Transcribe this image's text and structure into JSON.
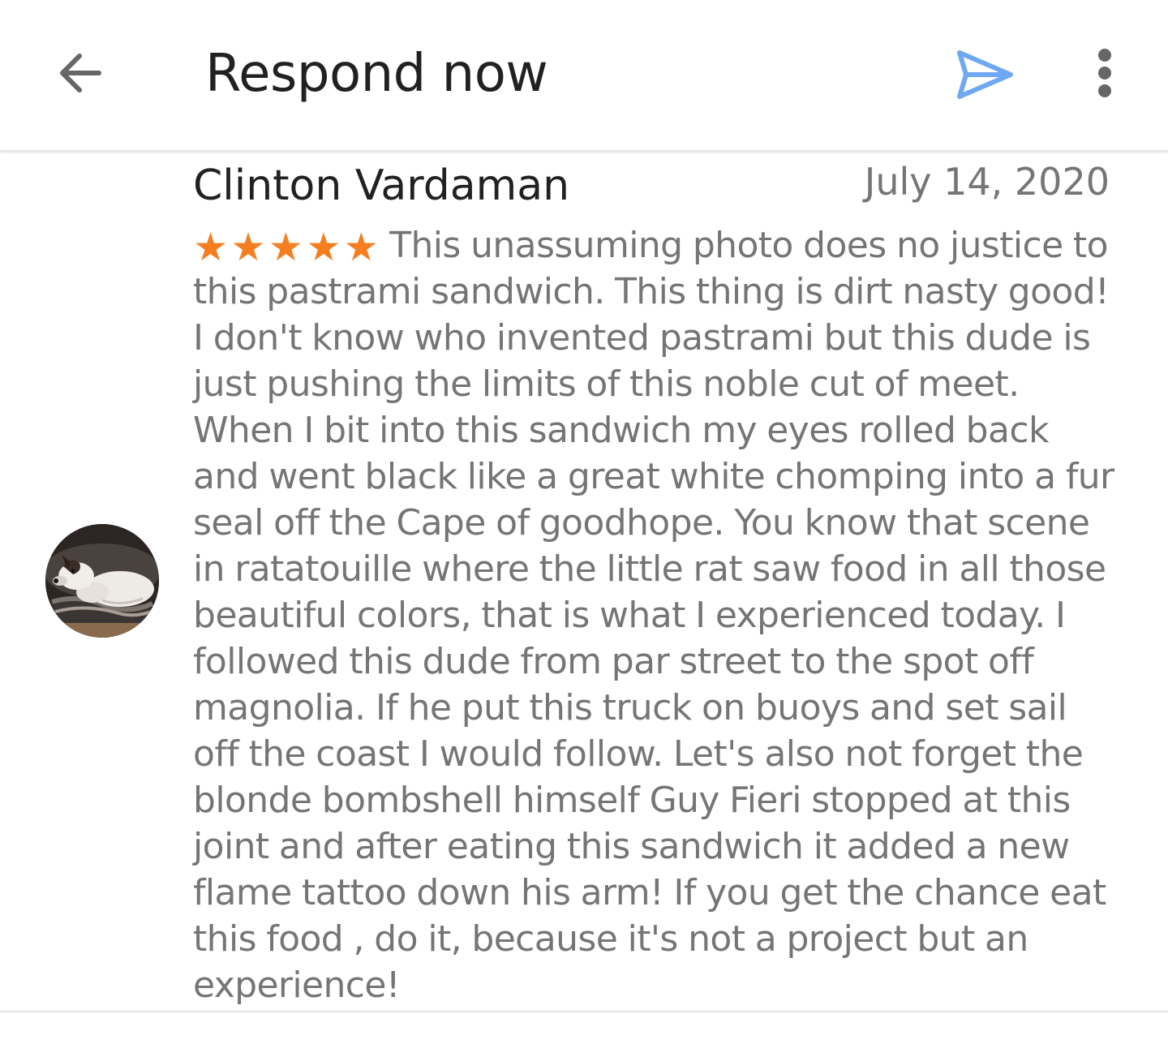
{
  "header": {
    "title": "Respond now",
    "back_icon": "arrow-back-icon",
    "send_icon": "send-icon",
    "more_icon": "more-vert-icon"
  },
  "review": {
    "reviewer_name": "Clinton Vardaman",
    "date": "July 14, 2020",
    "rating": 5,
    "text": "This unassuming photo does no justice to this pastrami sandwich. This thing is dirt nasty good! I don't know who invented pastrami but this dude is just pushing the limits of this noble cut of meet. When I bit into this sandwich my eyes rolled back and went black like a great white chomping into a fur seal off the Cape of goodhope. You know that scene in ratatouille where the little rat saw food in all those beautiful colors, that is what I experienced today. I followed this dude from par street to the spot off magnolia. If he put this truck on buoys and set sail off the coast I would follow. Let's also not forget the blonde bombshell himself Guy Fieri stopped at this joint and after eating this sandwich it added a new flame tattoo down his arm! If you get the chance eat this food , do it, because it's not a project but an experience!"
  },
  "colors": {
    "star": "#f47e20",
    "send_icon": "#6fa8f2",
    "title": "#212121",
    "body_text": "#757575",
    "icon_gray": "#666666"
  }
}
